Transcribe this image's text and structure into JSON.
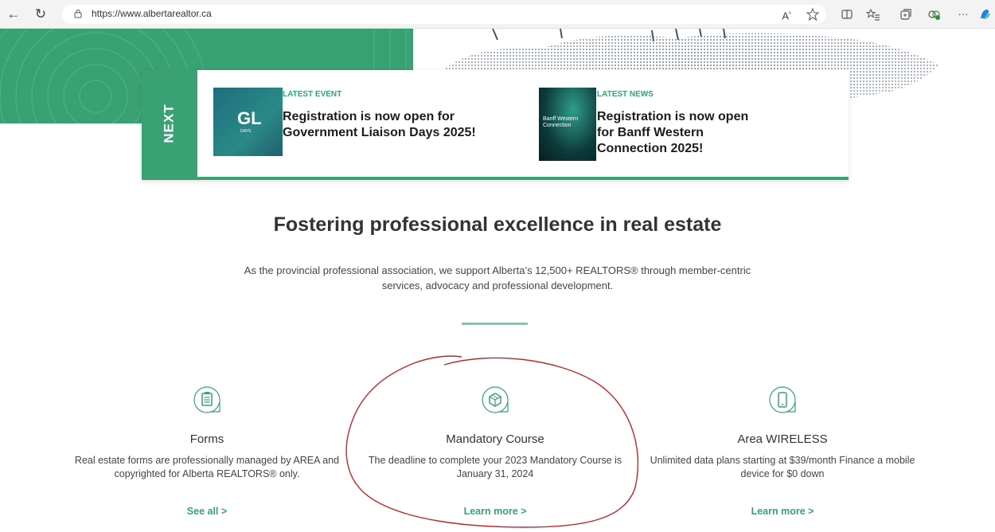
{
  "browser": {
    "url": "https://www.albertarealtor.ca"
  },
  "next_panel": {
    "label": "NEXT",
    "event": {
      "kicker": "LATEST EVENT",
      "title": "Registration is now open for Government Liaison Days 2025!",
      "thumb_text": "GL",
      "thumb_sub": "DAYS"
    },
    "news": {
      "kicker": "LATEST NEWS",
      "title": "Registration is now open for Banff Western Connection 2025!",
      "thumb_text": "Banff Western Connection"
    }
  },
  "main": {
    "headline": "Fostering professional excellence in real estate",
    "intro": "As the provincial professional association, we support Alberta’s 12,500+ REALTORS® through member-centric services, advocacy and professional development."
  },
  "features": [
    {
      "title": "Forms",
      "desc": "Real estate forms are professionally managed by AREA and copyrighted for Alberta REALTORS® only.",
      "link": "See all >"
    },
    {
      "title": "Mandatory Course",
      "desc": "The deadline to complete your 2023 Mandatory Course is January 31, 2024",
      "link": "Learn more >"
    },
    {
      "title": "Area WIRELESS",
      "desc": "Unlimited data plans starting at $39/month Finance a mobile device for $0 down",
      "link": "Learn more >"
    }
  ],
  "colors": {
    "brand_green": "#3aa175",
    "divider": "#7dc9a8",
    "annotation_red": "#c0262a"
  },
  "icons": {
    "back": "back-arrow-icon",
    "refresh": "refresh-icon",
    "lock": "lock-icon",
    "forms": "clipboard-icon",
    "course": "cube-icon",
    "wireless": "phone-icon"
  }
}
